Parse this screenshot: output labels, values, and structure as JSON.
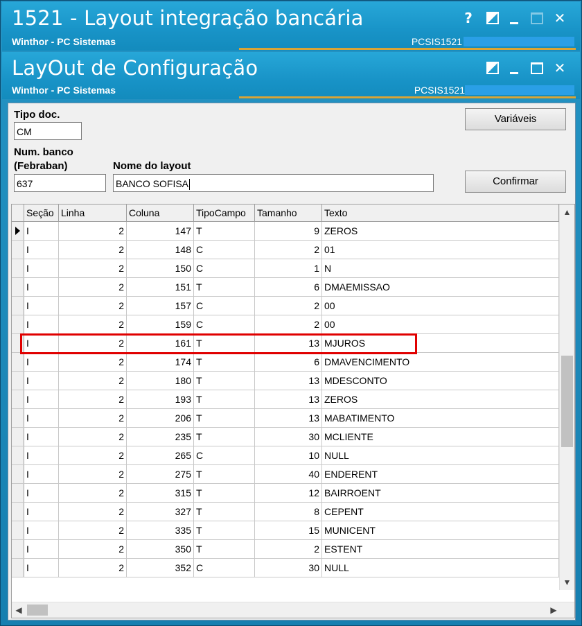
{
  "window1": {
    "title": "1521 - Layout integração bancária",
    "subtitle": "Winthor - PC Sistemas",
    "code": "PCSIS1521",
    "help_label": "?",
    "close_label": "✕"
  },
  "window2": {
    "title": "LayOut de Configuração",
    "subtitle": "Winthor - PC Sistemas",
    "code": "PCSIS1521",
    "close_label": "✕"
  },
  "form": {
    "tipo_doc_label": "Tipo doc.",
    "tipo_doc_value": "CM",
    "num_banco_label_1": "Num. banco",
    "num_banco_label_2": "(Febraban)",
    "num_banco_value": "637",
    "nome_layout_label": "Nome do layout",
    "nome_layout_value": "BANCO SOFISA",
    "variaveis_button": "Variáveis",
    "confirmar_button": "Confirmar"
  },
  "grid": {
    "columns": [
      "Seção",
      "Linha",
      "Coluna",
      "TipoCampo",
      "Tamanho",
      "Texto"
    ],
    "rows": [
      [
        "I",
        "2",
        "147",
        "T",
        "9",
        "ZEROS"
      ],
      [
        "I",
        "2",
        "148",
        "C",
        "2",
        "01"
      ],
      [
        "I",
        "2",
        "150",
        "C",
        "1",
        "N"
      ],
      [
        "I",
        "2",
        "151",
        "T",
        "6",
        "DMAEMISSAO"
      ],
      [
        "I",
        "2",
        "157",
        "C",
        "2",
        "00"
      ],
      [
        "I",
        "2",
        "159",
        "C",
        "2",
        "00"
      ],
      [
        "I",
        "2",
        "161",
        "T",
        "13",
        "MJUROS"
      ],
      [
        "I",
        "2",
        "174",
        "T",
        "6",
        "DMAVENCIMENTO"
      ],
      [
        "I",
        "2",
        "180",
        "T",
        "13",
        "MDESCONTO"
      ],
      [
        "I",
        "2",
        "193",
        "T",
        "13",
        "ZEROS"
      ],
      [
        "I",
        "2",
        "206",
        "T",
        "13",
        "MABATIMENTO"
      ],
      [
        "I",
        "2",
        "235",
        "T",
        "30",
        "MCLIENTE"
      ],
      [
        "I",
        "2",
        "265",
        "C",
        "10",
        "NULL"
      ],
      [
        "I",
        "2",
        "275",
        "T",
        "40",
        "ENDERENT"
      ],
      [
        "I",
        "2",
        "315",
        "T",
        "12",
        "BAIRROENT"
      ],
      [
        "I",
        "2",
        "327",
        "T",
        "8",
        "CEPENT"
      ],
      [
        "I",
        "2",
        "335",
        "T",
        "15",
        "MUNICENT"
      ],
      [
        "I",
        "2",
        "350",
        "T",
        "2",
        "ESTENT"
      ],
      [
        "I",
        "2",
        "352",
        "C",
        "30",
        "NULL"
      ]
    ],
    "current_row": 0,
    "highlighted_row": 6
  },
  "colors": {
    "title_bg": "#1893c7",
    "accent_line": "#d9a436",
    "highlight": "#e00000"
  }
}
